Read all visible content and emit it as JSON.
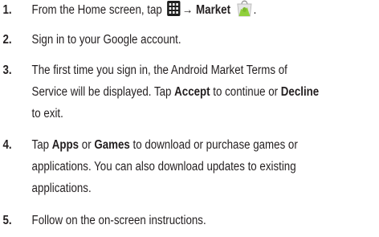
{
  "steps": [
    {
      "number": "1.",
      "prefix": "From the Home screen, tap ",
      "arrow": "→",
      "bold": "Market",
      "suffix": ".",
      "icons": [
        "apps-grid-icon",
        "market-bag-icon"
      ]
    },
    {
      "number": "2.",
      "text": "Sign in to your Google account."
    },
    {
      "number": "3.",
      "line1": "The first time you sign in, the Android Market Terms of",
      "line2_prefix": "Service will be displayed. Tap ",
      "accept": "Accept",
      "line2_mid": " to continue or ",
      "decline": "Decline",
      "line3": "to exit."
    },
    {
      "number": "4.",
      "line1_prefix": "Tap ",
      "apps": "Apps",
      "line1_mid": " or ",
      "games": "Games",
      "line1_suffix": " to download or purchase games or",
      "line2": "applications. You can also download updates to existing",
      "line3": "applications."
    },
    {
      "number": "5.",
      "text": "Follow on the on-screen instructions."
    }
  ]
}
